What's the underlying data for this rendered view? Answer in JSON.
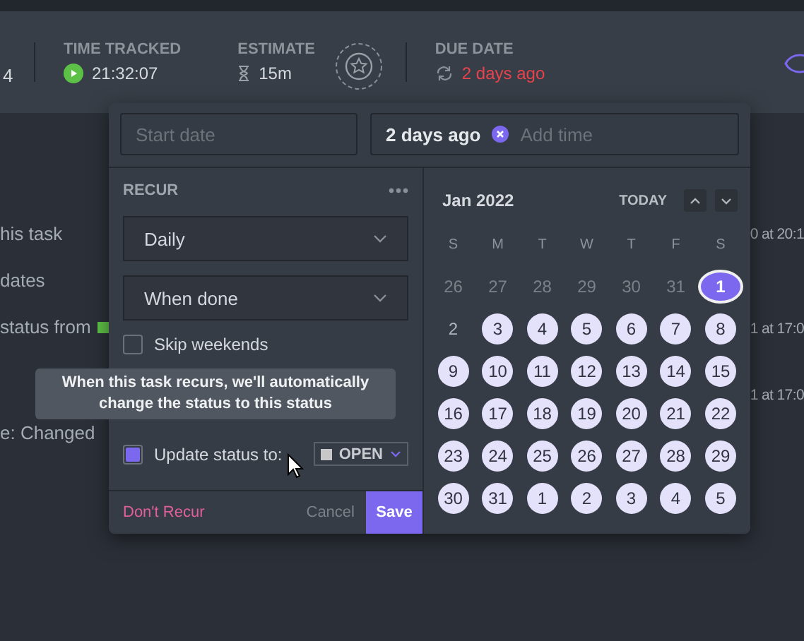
{
  "header": {
    "count": "4",
    "time_tracked": {
      "label": "TIME TRACKED",
      "value": "21:32:07"
    },
    "estimate": {
      "label": "ESTIMATE",
      "value": "15m"
    },
    "due_date": {
      "label": "DUE DATE",
      "value": "2 days ago"
    }
  },
  "activity": {
    "left": [
      "his task",
      "dates",
      "status from",
      "e: Changed"
    ],
    "right": [
      "0 at 20:1",
      "1 at 17:0",
      "1 at 17:0"
    ]
  },
  "dates": {
    "start": {
      "placeholder": "Start date"
    },
    "due": {
      "value": "2 days ago",
      "time_placeholder": "Add time"
    }
  },
  "recur": {
    "title": "RECUR",
    "frequency": "Daily",
    "trigger": "When done",
    "options": [
      {
        "label": "Skip weekends",
        "checked": false
      },
      {
        "label": "Update status to:",
        "checked": true
      }
    ],
    "status": "OPEN",
    "tooltip": "When this task recurs, we'll automatically change the status to this status",
    "dont_recur": "Don't Recur",
    "cancel": "Cancel",
    "save": "Save"
  },
  "calendar": {
    "month": "Jan 2022",
    "today": "TODAY",
    "weekdays": [
      "S",
      "M",
      "T",
      "W",
      "T",
      "F",
      "S"
    ],
    "days": [
      {
        "label": "26",
        "outside": true,
        "circled": false,
        "selected": false
      },
      {
        "label": "27",
        "outside": true,
        "circled": false,
        "selected": false
      },
      {
        "label": "28",
        "outside": true,
        "circled": false,
        "selected": false
      },
      {
        "label": "29",
        "outside": true,
        "circled": false,
        "selected": false
      },
      {
        "label": "30",
        "outside": true,
        "circled": false,
        "selected": false
      },
      {
        "label": "31",
        "outside": true,
        "circled": false,
        "selected": false
      },
      {
        "label": "1",
        "outside": false,
        "circled": true,
        "selected": true
      },
      {
        "label": "2",
        "outside": false,
        "circled": false,
        "selected": false
      },
      {
        "label": "3",
        "outside": false,
        "circled": true,
        "selected": false
      },
      {
        "label": "4",
        "outside": false,
        "circled": true,
        "selected": false
      },
      {
        "label": "5",
        "outside": false,
        "circled": true,
        "selected": false
      },
      {
        "label": "6",
        "outside": false,
        "circled": true,
        "selected": false
      },
      {
        "label": "7",
        "outside": false,
        "circled": true,
        "selected": false
      },
      {
        "label": "8",
        "outside": false,
        "circled": true,
        "selected": false
      },
      {
        "label": "9",
        "outside": false,
        "circled": true,
        "selected": false
      },
      {
        "label": "10",
        "outside": false,
        "circled": true,
        "selected": false
      },
      {
        "label": "11",
        "outside": false,
        "circled": true,
        "selected": false
      },
      {
        "label": "12",
        "outside": false,
        "circled": true,
        "selected": false
      },
      {
        "label": "13",
        "outside": false,
        "circled": true,
        "selected": false
      },
      {
        "label": "14",
        "outside": false,
        "circled": true,
        "selected": false
      },
      {
        "label": "15",
        "outside": false,
        "circled": true,
        "selected": false
      },
      {
        "label": "16",
        "outside": false,
        "circled": true,
        "selected": false
      },
      {
        "label": "17",
        "outside": false,
        "circled": true,
        "selected": false
      },
      {
        "label": "18",
        "outside": false,
        "circled": true,
        "selected": false
      },
      {
        "label": "19",
        "outside": false,
        "circled": true,
        "selected": false
      },
      {
        "label": "20",
        "outside": false,
        "circled": true,
        "selected": false
      },
      {
        "label": "21",
        "outside": false,
        "circled": true,
        "selected": false
      },
      {
        "label": "22",
        "outside": false,
        "circled": true,
        "selected": false
      },
      {
        "label": "23",
        "outside": false,
        "circled": true,
        "selected": false
      },
      {
        "label": "24",
        "outside": false,
        "circled": true,
        "selected": false
      },
      {
        "label": "25",
        "outside": false,
        "circled": true,
        "selected": false
      },
      {
        "label": "26",
        "outside": false,
        "circled": true,
        "selected": false
      },
      {
        "label": "27",
        "outside": false,
        "circled": true,
        "selected": false
      },
      {
        "label": "28",
        "outside": false,
        "circled": true,
        "selected": false
      },
      {
        "label": "29",
        "outside": false,
        "circled": true,
        "selected": false
      },
      {
        "label": "30",
        "outside": false,
        "circled": true,
        "selected": false
      },
      {
        "label": "31",
        "outside": false,
        "circled": true,
        "selected": false
      },
      {
        "label": "1",
        "outside": true,
        "circled": true,
        "selected": false
      },
      {
        "label": "2",
        "outside": true,
        "circled": true,
        "selected": false
      },
      {
        "label": "3",
        "outside": true,
        "circled": true,
        "selected": false
      },
      {
        "label": "4",
        "outside": true,
        "circled": true,
        "selected": false
      },
      {
        "label": "5",
        "outside": true,
        "circled": true,
        "selected": false
      }
    ]
  }
}
